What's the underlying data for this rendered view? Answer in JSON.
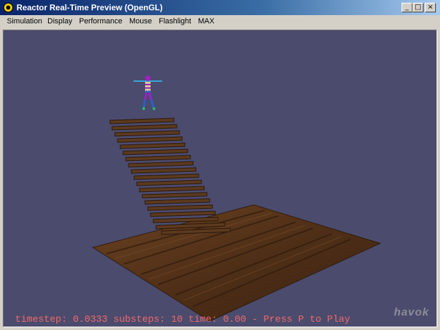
{
  "window": {
    "title": "Reactor Real-Time Preview (OpenGL)",
    "controls": {
      "minimize": "_",
      "maximize": "□",
      "close": "×"
    }
  },
  "menu": {
    "items": [
      "Simulation",
      "Display",
      "Performance",
      "Mouse",
      "Flashlight",
      "MAX"
    ]
  },
  "viewport": {
    "background_color": "#4b4b6d",
    "status_text": "timestep: 0.0333 substeps: 10 time: 0.00 - Press P to Play",
    "status_color": "#f06a6a",
    "logo_text": "havok"
  },
  "icons": [
    "reactor-app-icon",
    "minimize-icon",
    "maximize-icon",
    "close-icon"
  ]
}
